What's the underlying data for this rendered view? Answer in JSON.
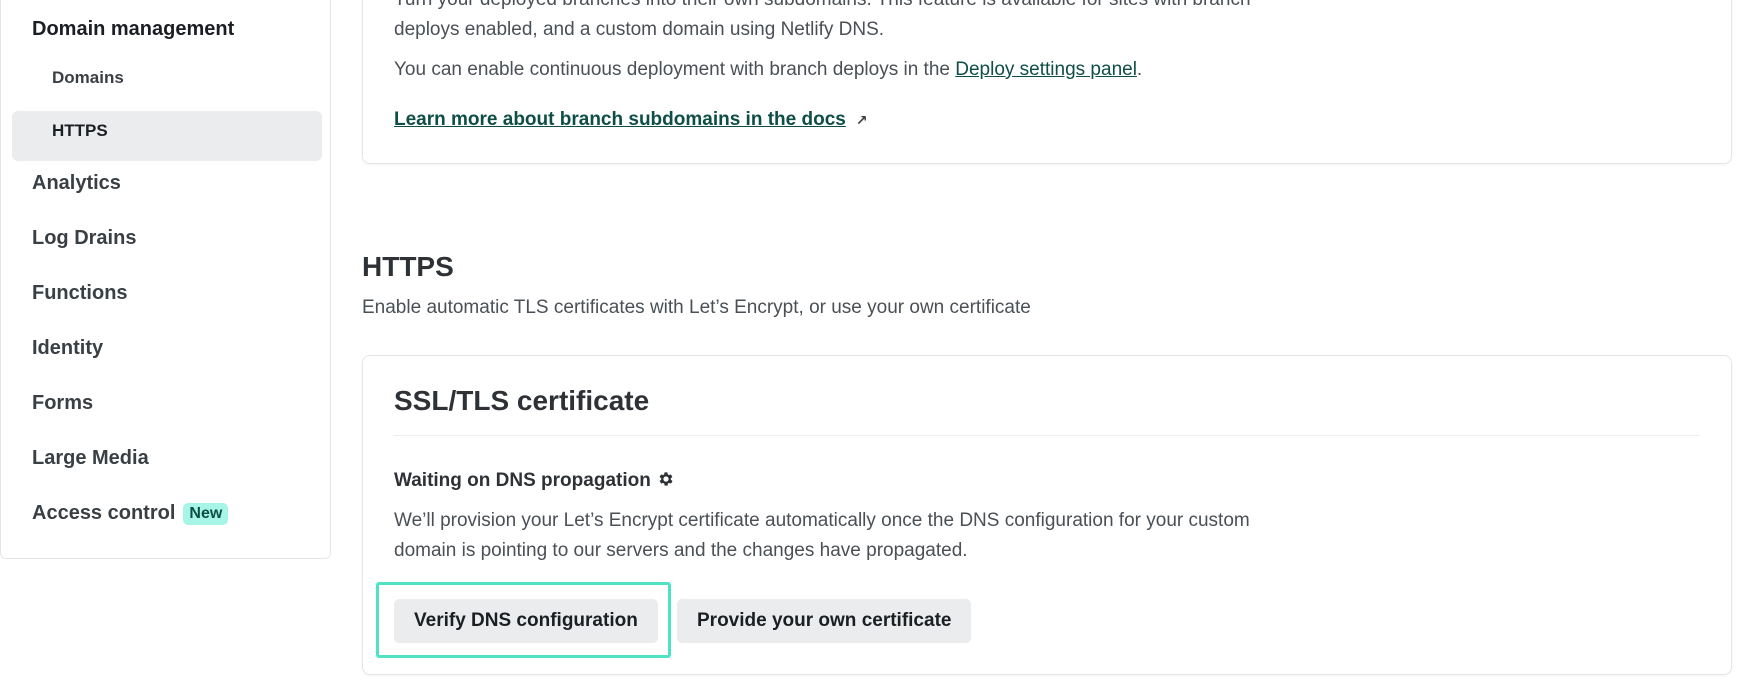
{
  "sidebar": {
    "domain_management": "Domain management",
    "domains": "Domains",
    "https": "HTTPS",
    "analytics": "Analytics",
    "log_drains": "Log Drains",
    "functions": "Functions",
    "identity": "Identity",
    "forms": "Forms",
    "large_media": "Large Media",
    "access_control": "Access control",
    "new_badge": "New"
  },
  "branch_card": {
    "intro": "Turn your deployed branches into their own subdomains. This feature is available for sites with branch deploys enabled, and a custom domain using Netlify DNS.",
    "continuous_prefix": "You can enable continuous deployment with branch deploys in the ",
    "deploy_settings_link": "Deploy settings panel",
    "continuous_suffix": ".",
    "learn_more_link": "Learn more about branch subdomains in the docs",
    "external_arrow": "↗"
  },
  "https_section": {
    "title": "HTTPS",
    "description": "Enable automatic TLS certificates with Let’s Encrypt, or use your own certificate"
  },
  "ssl_card": {
    "title": "SSL/TLS certificate",
    "status": "Waiting on DNS propagation",
    "body": "We’ll provision your Let’s Encrypt certificate automatically once the DNS configuration for your custom domain is pointing to our servers and the changes have propagated.",
    "verify_button": "Verify DNS configuration",
    "provide_button": "Provide your own certificate"
  },
  "colors": {
    "accent_teal": "#4fe3c5",
    "link_color": "#0e4e47",
    "badge_bg": "#a6f5e6",
    "active_nav_bg": "#ebecee"
  }
}
